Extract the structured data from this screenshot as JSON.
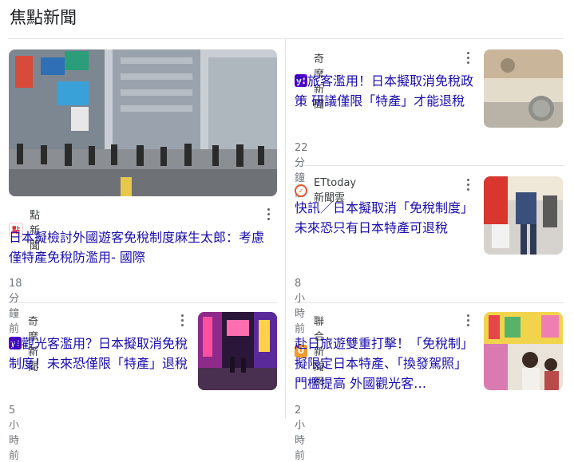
{
  "section_title": "焦點新聞",
  "colors": {
    "link": "#1a0dab",
    "meta": "#70757a",
    "divider": "#e3e3e3"
  },
  "articles": [
    {
      "source": "點新聞",
      "logo_icon": "dimnews-logo-icon",
      "headline": "日本擬檢討外國遊客免稅制度麻生太郎：考慮僅特產免稅防濫用- 國際",
      "time": "18 分鐘前",
      "image": "shibuya-crossing-photo"
    },
    {
      "source": "奇摩新聞",
      "logo_icon": "yahoo-logo-icon",
      "headline": "防旅客濫用！日本擬取消免稅政策 研議僅限「特產」才能退稅",
      "time": "22 分鐘前",
      "image": "yen-banknotes-photo"
    },
    {
      "source": "ETtoday新聞雲",
      "logo_icon": "ettoday-logo-icon",
      "headline": "快訊／日本擬取消「免稅制度」 未來恐只有日本特產可退稅",
      "time": "8 小時前",
      "image": "tax-free-shop-photo"
    },
    {
      "source": "奇摩新聞",
      "logo_icon": "yahoo-logo-icon",
      "headline": "遭觀光客濫用？日本擬取消免稅制度！未來恐僅限「特產」退稅",
      "time": "5 小時前",
      "image": "night-street-photo"
    },
    {
      "source": "聯合新聞網",
      "logo_icon": "udn-logo-icon",
      "headline": "赴日旅遊雙重打擊！「免稅制」擬限定日本特產、「換發駕照」門檻提高 外國觀光客…",
      "time": "2 小時前",
      "image": "drugstore-shoppers-photo"
    }
  ]
}
